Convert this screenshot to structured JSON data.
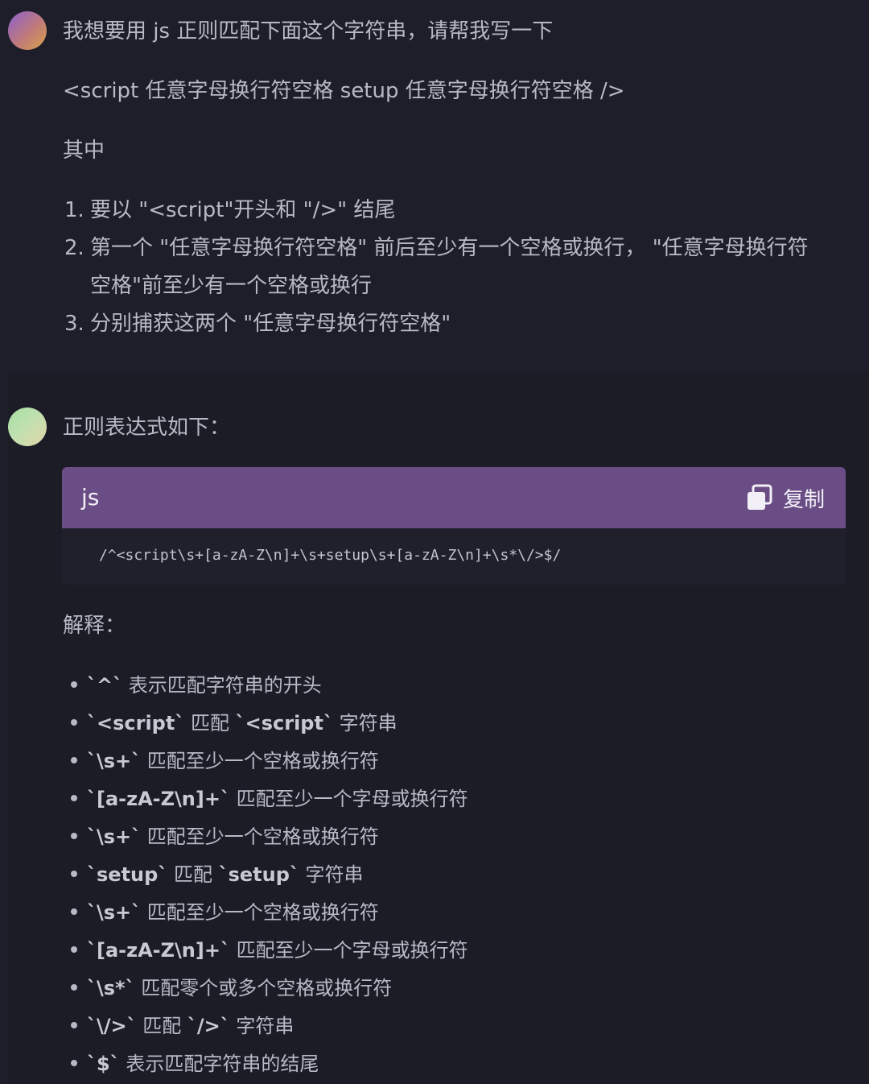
{
  "user_message": {
    "line1": "我想要用 js 正则匹配下面这个字符串，请帮我写一下",
    "line2": "<script 任意字母换行符空格 setup 任意字母换行符空格 />",
    "line3": "其中",
    "list": [
      {
        "num": "1.",
        "text": "要以 \"<script\"开头和 \"/>\" 结尾"
      },
      {
        "num": "2.",
        "text": "第一个 \"任意字母换行符空格\" 前后至少有一个空格或换行，  \"任意字母换行符",
        "cont": "空格\"前至少有一个空格或换行"
      },
      {
        "num": "3.",
        "text": "分别捕获这两个 \"任意字母换行符空格\""
      }
    ]
  },
  "bot_message": {
    "intro": "正则表达式如下：",
    "code_block": {
      "language": "js",
      "copy_label": "复制",
      "code": "/^<script\\s+[a-zA-Z\\n]+\\s+setup\\s+[a-zA-Z\\n]+\\s*\\/>$/"
    },
    "explain_heading": "解释：",
    "bullets": [
      {
        "code": "`^`",
        "text": " 表示匹配字符串的开头"
      },
      {
        "code": "`<script`",
        "text": " 匹配 ",
        "code2": "`<script`",
        "text2": " 字符串"
      },
      {
        "code": "`\\s+`",
        "text": " 匹配至少一个空格或换行符"
      },
      {
        "code": "`[a-zA-Z\\n]+`",
        "text": " 匹配至少一个字母或换行符"
      },
      {
        "code": "`\\s+`",
        "text": " 匹配至少一个空格或换行符"
      },
      {
        "code": "`setup`",
        "text": " 匹配 ",
        "code2": "`setup`",
        "text2": " 字符串"
      },
      {
        "code": "`\\s+`",
        "text": " 匹配至少一个空格或换行符"
      },
      {
        "code": "`[a-zA-Z\\n]+`",
        "text": " 匹配至少一个字母或换行符"
      },
      {
        "code": "`\\s*`",
        "text": " 匹配零个或多个空格或换行符"
      },
      {
        "code": "`\\/>`",
        "text": " 匹配 ",
        "code2": "`/>`",
        "text2": " 字符串"
      },
      {
        "code": "`$`",
        "text": " 表示匹配字符串的结尾"
      }
    ]
  }
}
